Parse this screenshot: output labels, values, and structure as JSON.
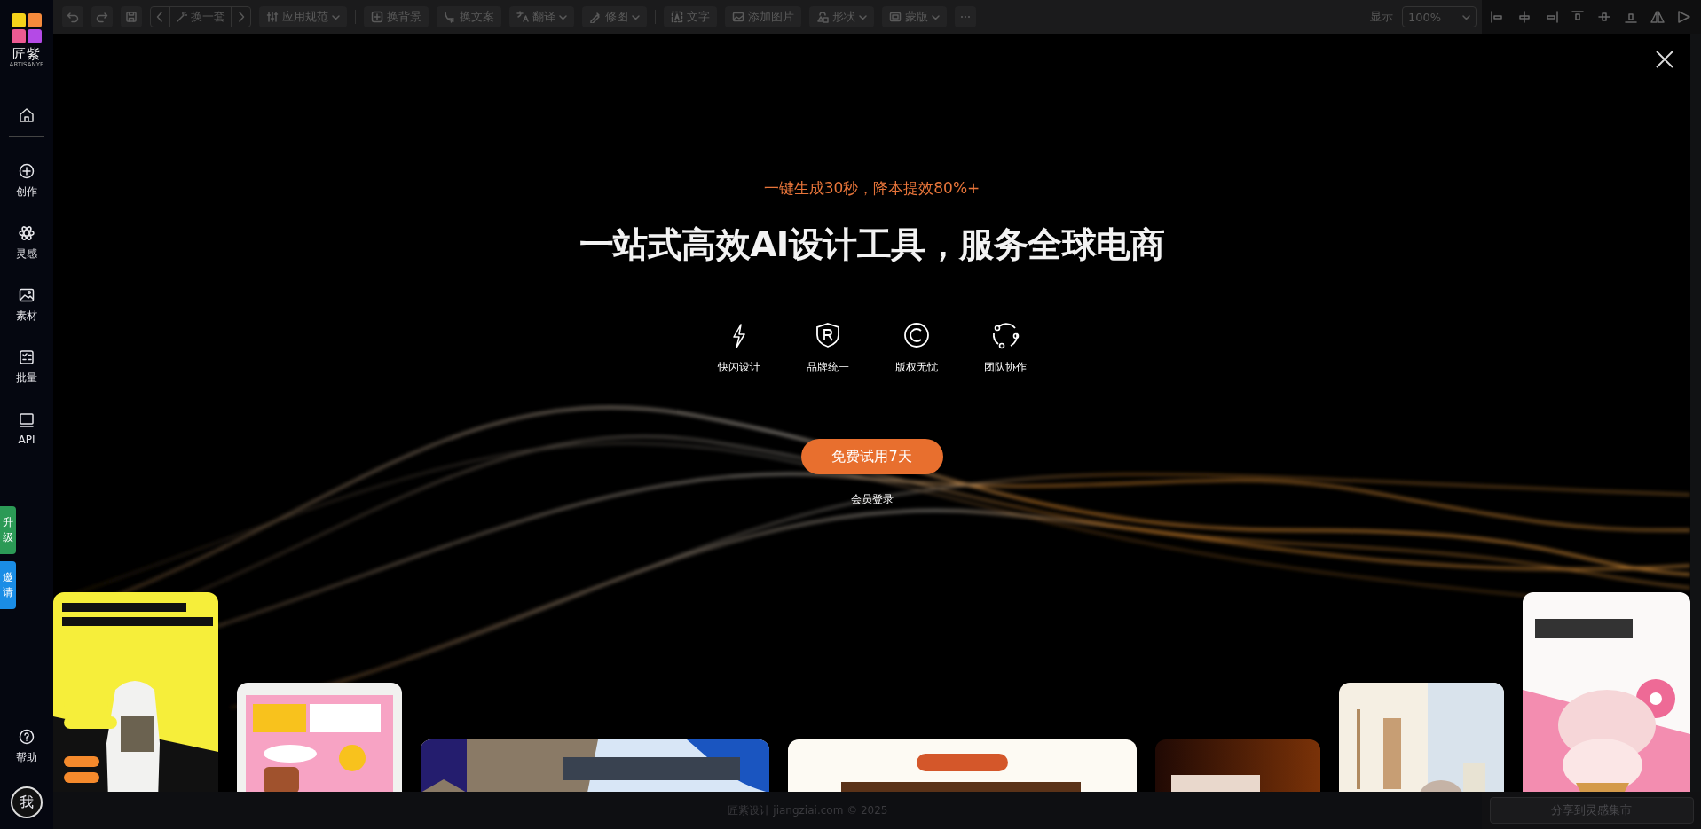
{
  "sidebar": {
    "logo_text": "匠紫",
    "logo_subtext": "ARTISANYE",
    "items": [
      {
        "label": "创作"
      },
      {
        "label": "灵感"
      },
      {
        "label": "素材"
      },
      {
        "label": "批量"
      },
      {
        "label": "API"
      }
    ],
    "side_tabs": [
      {
        "label": "升级",
        "color": "#2c9a56"
      },
      {
        "label": "邀请",
        "color": "#1a8de6"
      }
    ],
    "help": "帮助",
    "avatar": "我"
  },
  "toolbar": {
    "variant_label": "换一套",
    "items": [
      {
        "label": "应用规范",
        "dropdown": true
      },
      {
        "label": "换背景",
        "dropdown": false
      },
      {
        "label": "换文案",
        "dropdown": false
      },
      {
        "label": "翻译",
        "dropdown": true
      },
      {
        "label": "修图",
        "dropdown": true
      },
      {
        "label": "文字",
        "dropdown": false
      },
      {
        "label": "添加图片",
        "dropdown": false
      },
      {
        "label": "形状",
        "dropdown": true
      },
      {
        "label": "蒙版",
        "dropdown": true
      }
    ],
    "zoom_label": "显示",
    "zoom_value": "100%"
  },
  "modal": {
    "tagline": "一键生成30秒，降本提效80%+",
    "headline": "一站式高效AI设计工具，服务全球电商",
    "features": [
      {
        "label": "快闪设计"
      },
      {
        "label": "品牌统一"
      },
      {
        "label": "版权无忧"
      },
      {
        "label": "团队协作"
      }
    ],
    "cta": "免费试用7天",
    "login": "会员登录"
  },
  "footer": {
    "copyright": "匠紫设计 jiangziai.com © 2025",
    "share_button": "分享到灵感集市"
  }
}
